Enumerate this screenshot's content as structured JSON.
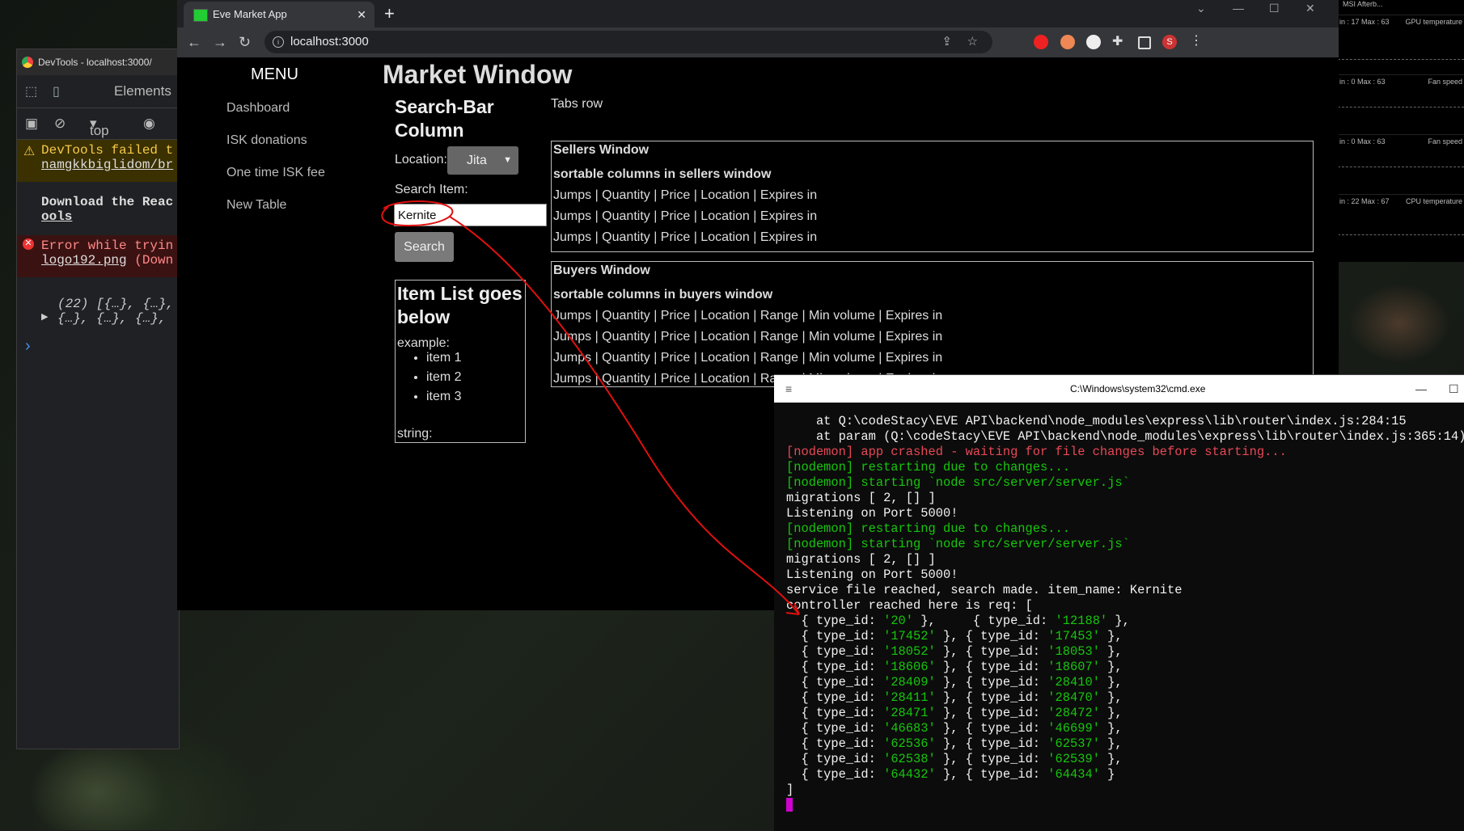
{
  "monitor": {
    "title": "MSI Afterb...",
    "rows": [
      {
        "label": "in : 17   Max : 63",
        "title": "GPU temperature"
      },
      {
        "label": "in : 0   Max : 63",
        "title": "Fan speed"
      },
      {
        "label": "in : 0   Max : 63",
        "title": "Fan speed"
      },
      {
        "label": "in : 22   Max : 67",
        "title": "CPU temperature"
      }
    ]
  },
  "devtools": {
    "window_title": "DevTools - localhost:3000/",
    "tab_elements": "Elements",
    "context": "top",
    "warning": {
      "text": "DevTools failed t",
      "link": "namgkkbiglidom/br"
    },
    "plain": {
      "text": "Download the Reac",
      "link": "ools"
    },
    "error": {
      "text": "Error while tryin",
      "link": "logo192.png",
      "tail": "(Down"
    },
    "object_line1": "(22) [{…}, {…},",
    "object_line2": "{…}, {…}, {…},",
    "prompt": "›"
  },
  "browser": {
    "tab_title": "Eve Market App",
    "url": "localhost:3000",
    "profile_initial": "S"
  },
  "page": {
    "menu_title": "MENU",
    "menu_items": [
      "Dashboard",
      "ISK donations",
      "One time ISK fee",
      "New Table"
    ],
    "title": "Market Window",
    "search_bar_title": "Search-Bar Column",
    "location_label": "Location:",
    "location_value": "Jita",
    "search_item_label": "Search Item:",
    "search_value": "Kernite",
    "search_button": "Search",
    "item_list_title": "Item List goes below",
    "example_label": "example:",
    "example_items": [
      "item 1",
      "item 2",
      "item 3"
    ],
    "string_label": "string:",
    "tabs_row": "Tabs row",
    "sellers": {
      "title": "Sellers Window",
      "subtitle": "sortable columns in sellers window",
      "rows": [
        "Jumps | Quantity | Price | Location | Expires in",
        "Jumps | Quantity | Price | Location | Expires in",
        "Jumps | Quantity | Price | Location | Expires in"
      ]
    },
    "buyers": {
      "title": "Buyers Window",
      "subtitle": "sortable columns in buyers window",
      "rows": [
        "Jumps | Quantity | Price | Location | Range | Min volume | Expires in",
        "Jumps | Quantity | Price | Location | Range | Min volume | Expires in",
        "Jumps | Quantity | Price | Location | Range | Min volume | Expires in",
        "Jumps | Quantity | Price | Location | Range | Min volume | Expires in"
      ]
    }
  },
  "cmd": {
    "title": "C:\\Windows\\system32\\cmd.exe",
    "lines": [
      {
        "color": "wht",
        "text": "    at Q:\\codeStacy\\EVE API\\backend\\node_modules\\express\\lib\\router\\index.js:284:15"
      },
      {
        "color": "wht",
        "text": "    at param (Q:\\codeStacy\\EVE API\\backend\\node_modules\\express\\lib\\router\\index.js:365:14)"
      },
      {
        "color": "red",
        "text": "[nodemon] app crashed - waiting for file changes before starting..."
      },
      {
        "color": "grn",
        "text": "[nodemon] restarting due to changes..."
      },
      {
        "color": "grn",
        "text": "[nodemon] starting `node src/server/server.js`"
      },
      {
        "color": "wht",
        "text": "migrations [ 2, [] ]"
      },
      {
        "color": "wht",
        "text": "Listening on Port 5000!"
      },
      {
        "color": "grn",
        "text": "[nodemon] restarting due to changes..."
      },
      {
        "color": "grn",
        "text": "[nodemon] starting `node src/server/server.js`"
      },
      {
        "color": "wht",
        "text": "migrations [ 2, [] ]"
      },
      {
        "color": "wht",
        "text": "Listening on Port 5000!"
      },
      {
        "color": "wht",
        "text": "service file reached, search made. item_name: Kernite"
      },
      {
        "color": "wht",
        "text": "controller reached here is req: ["
      }
    ],
    "type_id_pairs": [
      [
        "20",
        "12188"
      ],
      [
        "17452",
        "17453"
      ],
      [
        "18052",
        "18053"
      ],
      [
        "18606",
        "18607"
      ],
      [
        "28409",
        "28410"
      ],
      [
        "28411",
        "28470"
      ],
      [
        "28471",
        "28472"
      ],
      [
        "46683",
        "46699"
      ],
      [
        "62536",
        "62537"
      ],
      [
        "62538",
        "62539"
      ],
      [
        "64432",
        "64434"
      ]
    ],
    "closing": "]"
  },
  "colors": {
    "annotation": "#e01010",
    "nodemon_green": "#16c60c",
    "nodemon_red": "#e74856",
    "cursor": "#d000d0"
  }
}
